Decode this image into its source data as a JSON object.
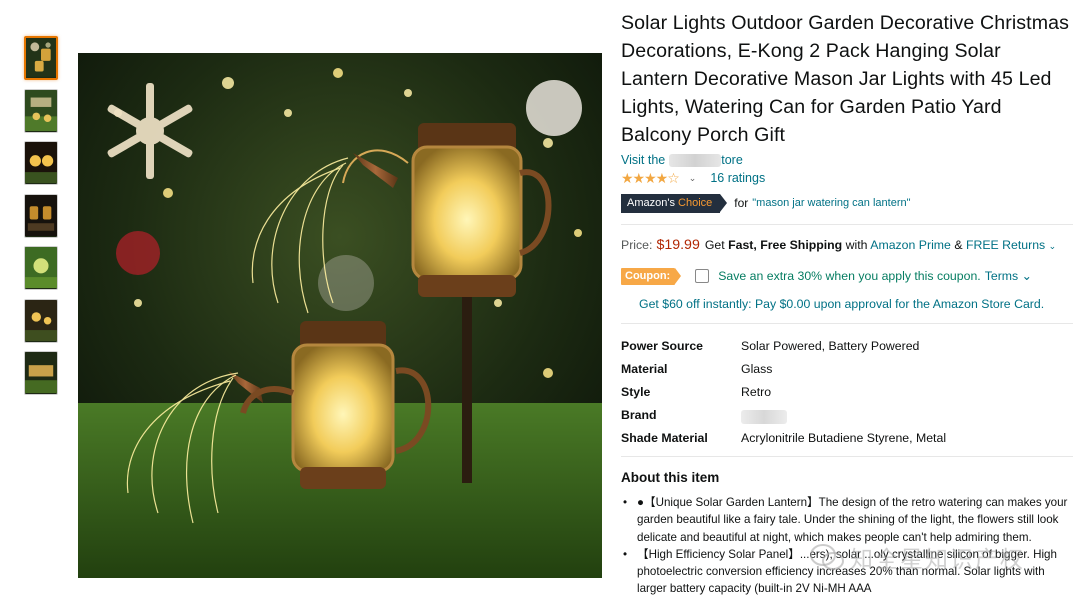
{
  "thumbnails": [
    {
      "name": "thumb-1",
      "active": true
    },
    {
      "name": "thumb-2",
      "active": false
    },
    {
      "name": "thumb-3",
      "active": false
    },
    {
      "name": "thumb-4",
      "active": false
    },
    {
      "name": "thumb-5",
      "active": false
    },
    {
      "name": "thumb-6",
      "active": false
    },
    {
      "name": "thumb-7",
      "active": false
    }
  ],
  "product": {
    "title": "Solar Lights Outdoor Garden Decorative Christmas Decorations, E-Kong 2 Pack Hanging Solar Lantern Decorative Mason Jar Lights with 45 Led Lights, Watering Can for Garden Patio Yard Balcony Porch Gift",
    "store_prefix": "Visit the",
    "store_suffix": "tore",
    "stars": "★★★★☆",
    "rating_chevron": "⌄",
    "ratings_count": "16 ratings",
    "badge_amazons": "Amazon's",
    "badge_choice": "Choice",
    "choice_for": "for",
    "choice_query": "\"mason jar watering can lantern\""
  },
  "pricing": {
    "label": "Price:",
    "price": "$19.99",
    "get": "Get",
    "fast_free": "Fast, Free Shipping",
    "with": "with",
    "prime": "Amazon Prime",
    "amp": "&",
    "returns": "FREE Returns",
    "returns_chevron": "⌄"
  },
  "coupon": {
    "badge": "Coupon:",
    "text": "Save an extra 30% when you apply this coupon.",
    "terms": "Terms ⌄"
  },
  "card_offer": "Get $60 off instantly: Pay $0.00 upon approval for the Amazon Store Card.",
  "specs": [
    {
      "key": "Power Source",
      "value": "Solar Powered, Battery Powered"
    },
    {
      "key": "Material",
      "value": "Glass"
    },
    {
      "key": "Style",
      "value": "Retro"
    },
    {
      "key": "Brand",
      "value": ""
    },
    {
      "key": "Shade Material",
      "value": "Acrylonitrile Butadiene Styrene, Metal"
    }
  ],
  "about": {
    "heading": "About this item",
    "bullets": [
      "●【Unique Solar Garden Lantern】The design of the retro watering can makes your garden beautiful like a fairy tale. Under the shining of the light, the flowers still look delicate and beautiful at night, which makes people can't help admiring them.",
      "【High Efficiency Solar Panel】...ers), solar ...oly crystalline silicon of bigger. High photoelectric conversion efficiency increases 20% than normal. Solar lights with larger battery capacity (built-in 2V Ni-MH AAA"
    ]
  },
  "watermark": "知全星知识产权",
  "colors": {
    "link": "#007185",
    "price": "#b12704",
    "coupon": "#f7a847",
    "badge_bg": "#232f3e",
    "star": "#f2a742",
    "coupon_text": "#067d62"
  }
}
